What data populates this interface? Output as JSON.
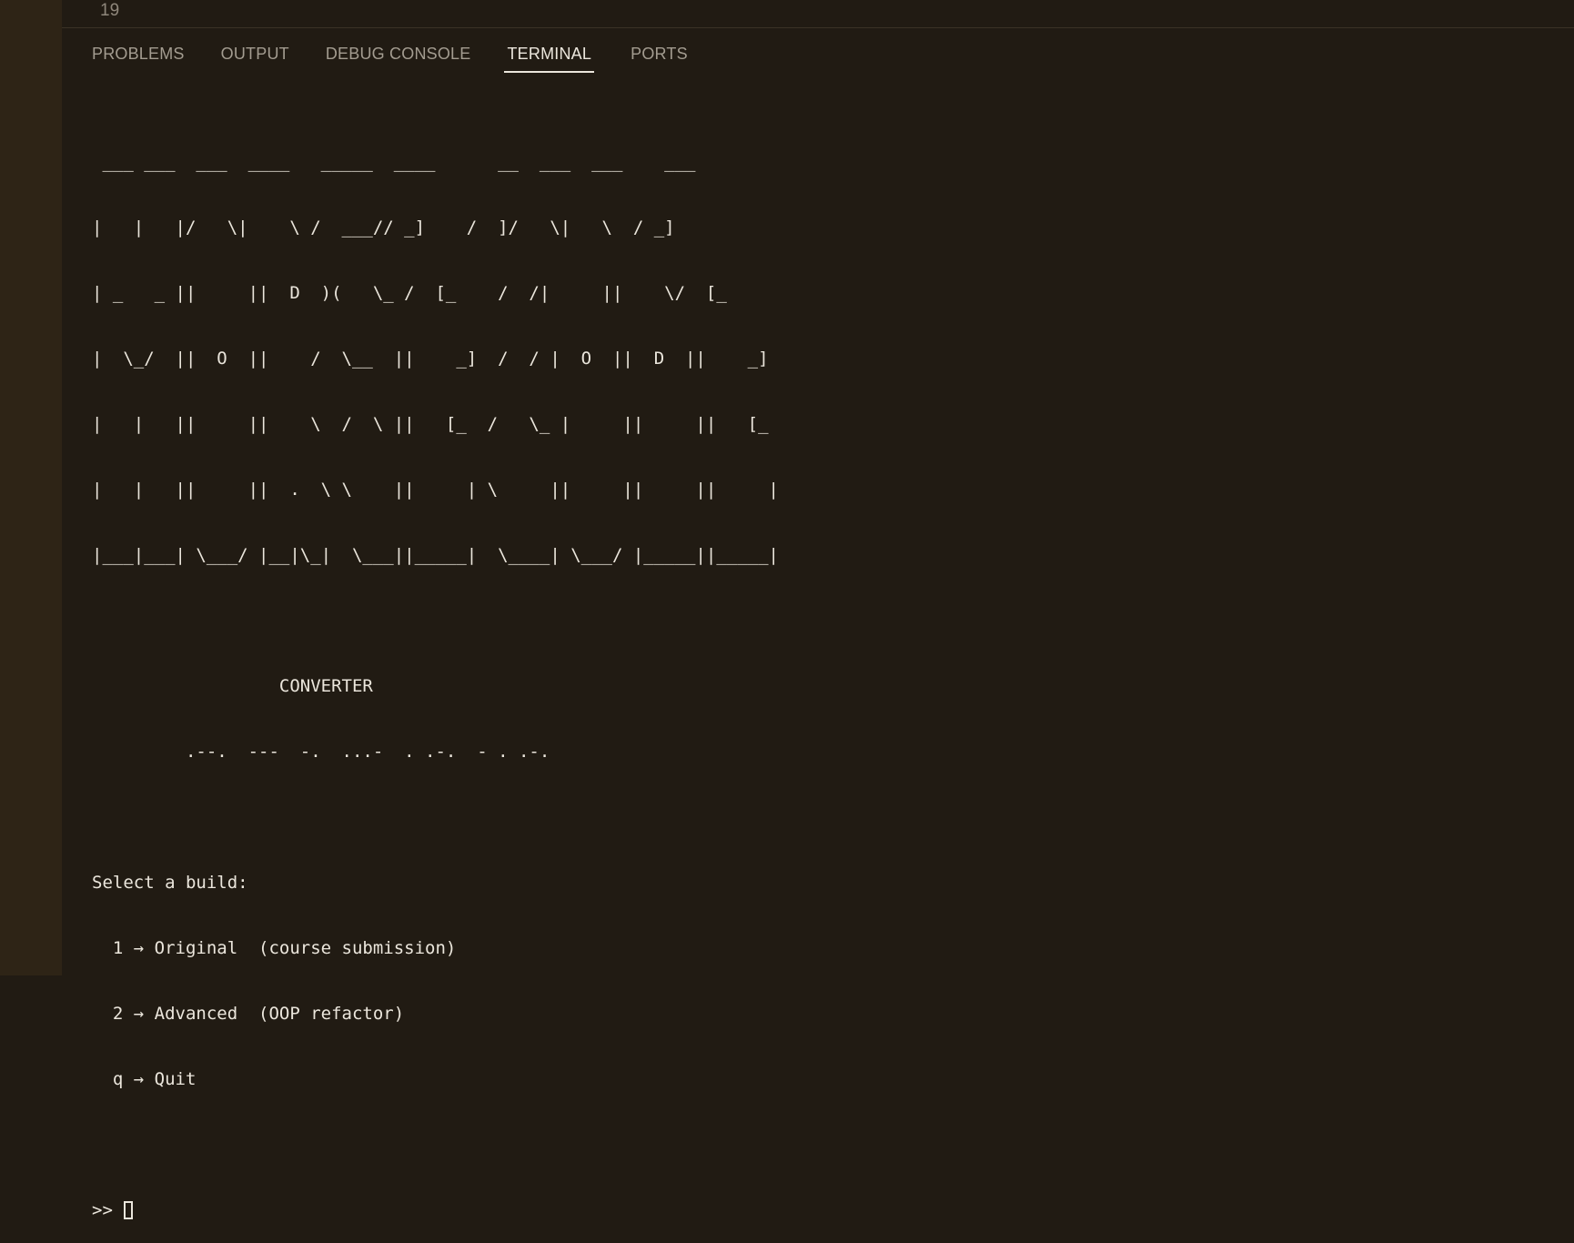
{
  "editor": {
    "line_number": "19"
  },
  "panel": {
    "tabs": [
      {
        "label": "PROBLEMS",
        "active": false
      },
      {
        "label": "OUTPUT",
        "active": false
      },
      {
        "label": "DEBUG CONSOLE",
        "active": false
      },
      {
        "label": "TERMINAL",
        "active": true
      },
      {
        "label": "PORTS",
        "active": false
      }
    ]
  },
  "terminal": {
    "ascii_art": [
      " ___ ___  ___  ____   _____  ____      __  ___  ___    ___",
      "|   |   |/   \\|    \\ /  ___// _]    /  ]/   \\|   \\  / _]",
      "| _   _ ||     ||  D  )(   \\_ /  [_    /  /|     ||    \\/  [_",
      "|  \\_/  ||  O  ||    /  \\__  ||    _]  /  / |  O  ||  D  ||    _]",
      "|   |   ||     ||    \\  /  \\ ||   [_  /   \\_ |     ||     ||   [_",
      "|   |   ||     ||  .  \\ \\    ||     | \\     ||     ||     ||     |",
      "|___|___| \\___/ |__|\\_|  \\___||_____|  \\____| \\___/ |_____||_____|"
    ],
    "subtitle": "                  CONVERTER",
    "morse_line": "         .--.  ---  -.  ...-  . .-.  - . .-.",
    "menu_title": "Select a build:",
    "options": [
      "  1 → Original  (course submission)",
      "  2 → Advanced  (OOP refactor)",
      "  q → Quit"
    ],
    "prompt": ">>"
  }
}
